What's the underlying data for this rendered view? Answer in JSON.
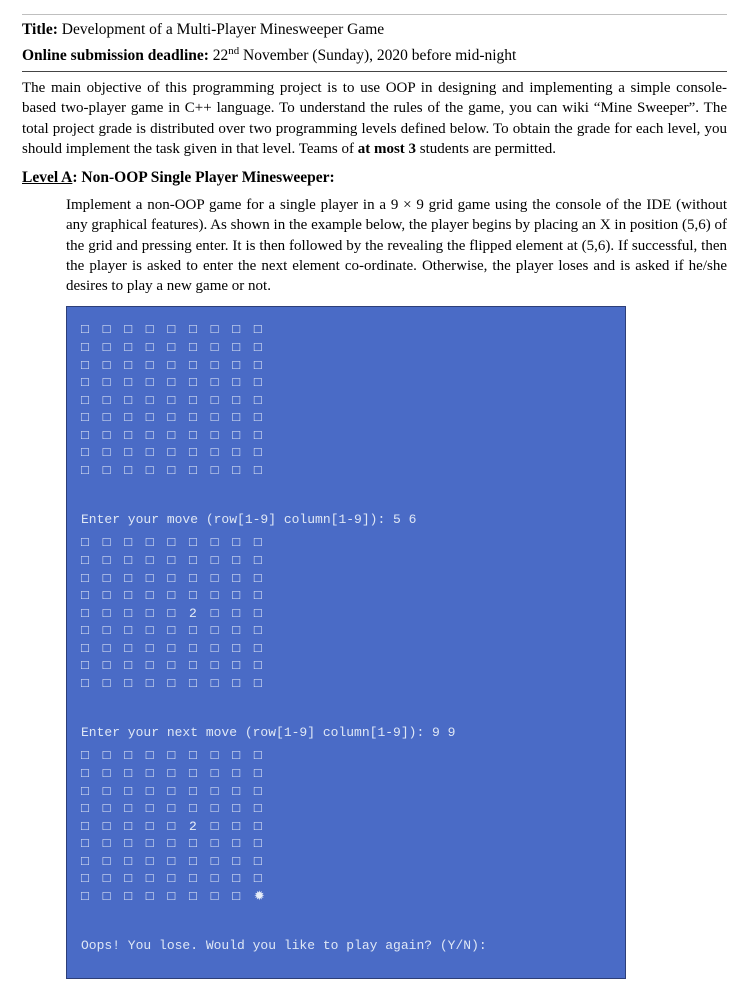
{
  "title": {
    "label": "Title:",
    "value": "Development of a Multi-Player Minesweeper Game"
  },
  "deadline": {
    "label": "Online submission deadline:",
    "day": "22",
    "ord": "nd",
    "rest": " November (Sunday), 2020 before mid-night"
  },
  "intro": "The main objective of this programming project is to use OOP in designing and implementing a simple console-based two-player game in C++ language. To understand the rules of the game, you can wiki “Mine Sweeper”. The total project grade is distributed over two programming levels defined below. To obtain the grade for each level, you should implement the task given in that level. Teams of at most 3 students are permitted.",
  "level_a": {
    "label": "Level A",
    "heading": ": Non-OOP Single Player Minesweeper:",
    "para": "Implement a non-OOP game for a single player in a 9 × 9 grid game using the console of the IDE (without any graphical features). As shown in the example below, the player begins by placing an X in position (5,6) of the grid and pressing enter. It is then followed by the revealing the flipped element at (5,6). If successful, then the player is asked to enter the next element co-ordinate. Otherwise, the player loses and is asked if he/she desires to play a new game or not."
  },
  "console": {
    "cell": "□",
    "grid1_row": "□ □ □ □ □ □ □ □ □",
    "prompt1": "Enter your move (row[1-9] column[1-9]): 5 6",
    "grid2_row5": "□ □ □ □ □ 2 □ □ □",
    "prompt2": "Enter your next move (row[1-9] column[1-9]): 9 9",
    "grid3_row9": "□ □ □ □ □ □ □ □ ✹",
    "lose": "Oops! You lose. Would you like to play again? (Y/N):"
  }
}
